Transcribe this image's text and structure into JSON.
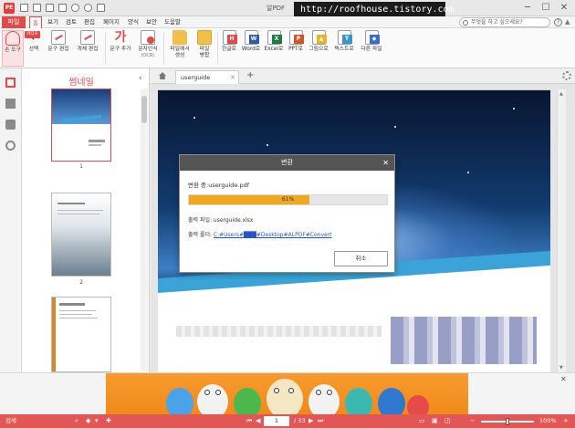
{
  "window": {
    "logo": "PE",
    "title": "알PDF",
    "overlay_url": "http://roofhouse.tistory.com",
    "minimize": "─",
    "maximize": "☐",
    "close": "✕"
  },
  "menu": {
    "file": "파일",
    "items": [
      "홈",
      "보기",
      "검토",
      "편집",
      "페이지",
      "양식",
      "보안",
      "도움말"
    ],
    "search_placeholder": "무엇을 하고 싶으세요?",
    "help": "?"
  },
  "ribbon": {
    "hand_tool": "손 도구",
    "select": "선택",
    "select_badge": "카디오",
    "text_edit": "문구 편집",
    "object_edit": "개체 편집",
    "add_text": "문구 추가",
    "ocr": "문자인식",
    "ocr_sub": "(OCR)",
    "create_from_file": "파일에서",
    "create_from_file_2": "생성",
    "merge": "파일",
    "merge_2": "병합",
    "to_hwp": "한글로",
    "to_word": "Word로",
    "to_excel": "Excel로",
    "to_ppt": "PPT로",
    "to_image": "그림으로",
    "to_text": "텍스트로",
    "to_other": "다른 파일",
    "fmt_letters": {
      "hwp": "H",
      "word": "W",
      "excel": "X",
      "ppt": "P",
      "image": "▲",
      "text": "T",
      "other": "◆"
    }
  },
  "thumbnails": {
    "title": "썸네일",
    "pages": [
      "1",
      "2",
      "3"
    ]
  },
  "doc": {
    "tab_name": "userguide",
    "tab_close": "✕",
    "tab_add": "+"
  },
  "dialog": {
    "title": "변환",
    "status": "변환 중:userguide.pdf",
    "progress": 0.61,
    "progress_label": "61%",
    "output_file_label": "출력 파일: ",
    "output_file": "userguide.xlsx",
    "output_folder_label": "출력 폴더: ",
    "output_folder": "C:#Users#███#Desktop#ALPDF#Convert",
    "cancel": "취소"
  },
  "statusbar": {
    "left_label": "검색",
    "current_page": "1",
    "total_pages": "/ 33",
    "zoom": 1.0,
    "zoom_label": "100%"
  },
  "colors": {
    "accent": "#e04a4a",
    "statusbar": "#e25656",
    "progress": "#f0a81e"
  }
}
